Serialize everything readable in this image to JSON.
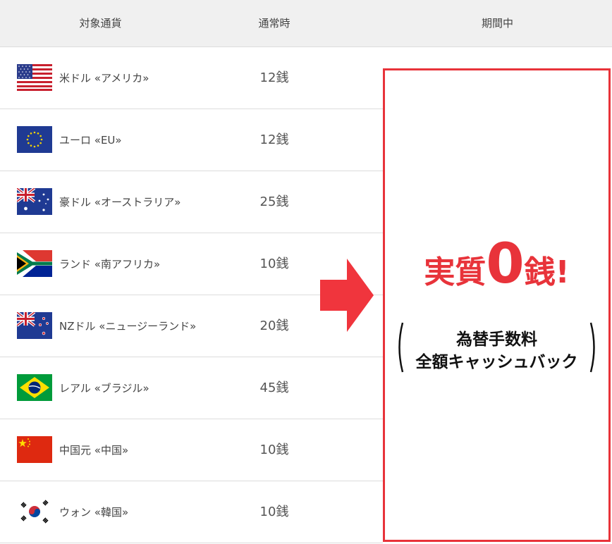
{
  "header": {
    "col_currency": "対象通貨",
    "col_normal": "通常時",
    "col_period": "期間中"
  },
  "rows": [
    {
      "name": "米ドル «アメリカ»",
      "fee": "12銭",
      "flag": "us-flag-icon"
    },
    {
      "name": "ユーロ «EU»",
      "fee": "12銭",
      "flag": "eu-flag-icon"
    },
    {
      "name": "豪ドル «オーストラリア»",
      "fee": "25銭",
      "flag": "australia-flag-icon"
    },
    {
      "name": "ランド «南アフリカ»",
      "fee": "10銭",
      "flag": "south-africa-flag-icon"
    },
    {
      "name": "NZドル «ニュージーランド»",
      "fee": "20銭",
      "flag": "new-zealand-flag-icon"
    },
    {
      "name": "レアル «ブラジル»",
      "fee": "45銭",
      "flag": "brazil-flag-icon"
    },
    {
      "name": "中国元 «中国»",
      "fee": "10銭",
      "flag": "china-flag-icon"
    },
    {
      "name": "ウォン «韓国»",
      "fee": "10銭",
      "flag": "korea-flag-icon"
    }
  ],
  "promo": {
    "part1": "実質",
    "part2": "0",
    "part3": "銭",
    "part4": "!",
    "sub1": "為替手数料",
    "sub2": "全額キャッシュバック"
  },
  "colors": {
    "accent": "#e8333a",
    "header_bg": "#f0f0f0"
  }
}
